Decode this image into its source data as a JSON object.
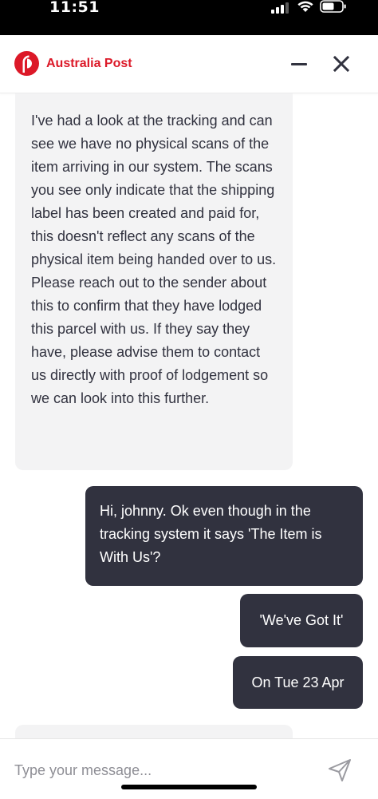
{
  "status_bar": {
    "time": "11:51"
  },
  "header": {
    "brand_name": "Australia Post",
    "brand_color": "#dc1928",
    "icons": [
      "auspost-logo",
      "minimize-icon",
      "close-icon"
    ]
  },
  "messages": [
    {
      "sender": "agent",
      "text": "I've had a look at the tracking and can see we have no physical scans of the item arriving in our system. The scans you see only indicate that the shipping label has been created and paid for, this doesn't reflect any scans of the physical item being handed over to us. Please reach out to the sender about this to confirm that they have lodged this parcel with us. If they say they have, please advise them to contact us directly with proof of lodgement so we can look into this further."
    },
    {
      "sender": "user",
      "text": "Hi, johnny. Ok even though in the tracking system it says 'The Item is With Us'?"
    },
    {
      "sender": "user",
      "text": "'We've Got It'"
    },
    {
      "sender": "user",
      "text": "On Tue 23 Apr"
    }
  ],
  "composer": {
    "placeholder": "Type your message...",
    "value": "",
    "send_icon": "send-icon"
  },
  "colors": {
    "agent_bubble": "#f3f3f4",
    "user_bubble": "#31323f",
    "text_dark": "#31323f"
  }
}
